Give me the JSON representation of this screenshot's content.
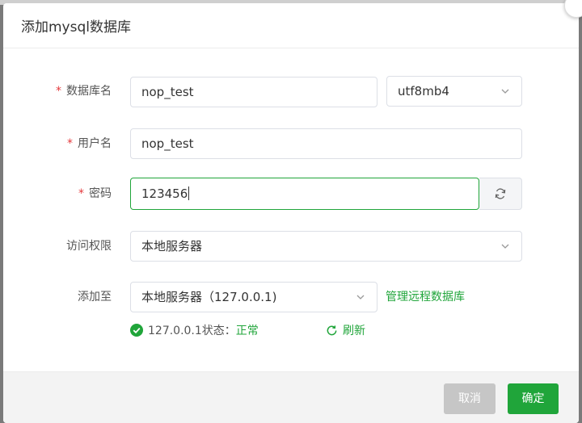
{
  "dialog": {
    "title": "添加mysql数据库"
  },
  "form": {
    "db_name": {
      "label": "数据库名",
      "value": "nop_test",
      "required": true
    },
    "charset": {
      "value": "utf8mb4"
    },
    "username": {
      "label": "用户名",
      "value": "nop_test",
      "required": true
    },
    "password": {
      "label": "密码",
      "value": "123456",
      "required": true
    },
    "access": {
      "label": "访问权限",
      "value": "本地服务器"
    },
    "add_to": {
      "label": "添加至",
      "value": "本地服务器（127.0.0.1)"
    },
    "manage_remote_link": "管理远程数据库",
    "status": {
      "host": "127.0.0.1状态：",
      "state": "正常",
      "refresh_label": "刷新"
    },
    "required_mark": "*"
  },
  "footer": {
    "cancel_label": "取消",
    "confirm_label": "确定"
  },
  "colors": {
    "accent": "#20a53a",
    "required": "#e4393c",
    "cancel_bg": "#c6c6c6"
  },
  "icons": {
    "close": "close-icon",
    "chevron": "chevron-down-icon",
    "refresh": "refresh-icon",
    "check": "check-circle-icon"
  }
}
